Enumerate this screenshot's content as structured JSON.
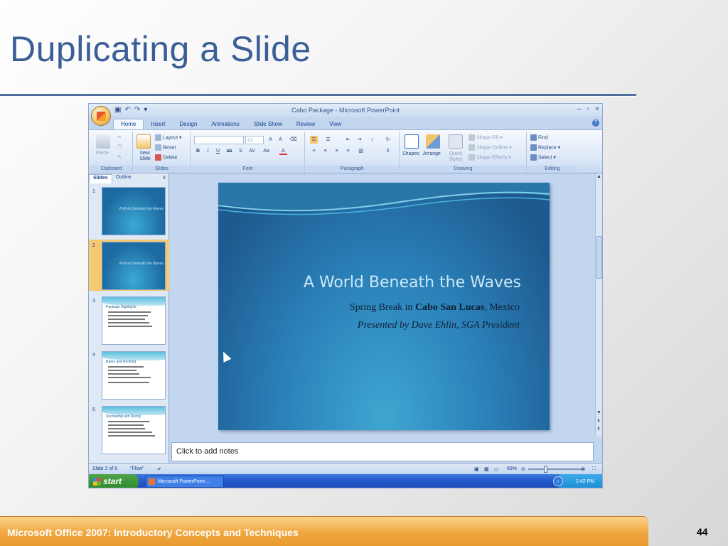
{
  "page": {
    "title": "Duplicating a Slide",
    "footer": "Microsoft Office 2007: Introductory Concepts and Techniques",
    "page_number": "44"
  },
  "window": {
    "title": "Cabo Package - Microsoft PowerPoint",
    "controls": [
      "–",
      "▫",
      "×"
    ]
  },
  "ribbon": {
    "tabs": [
      "Home",
      "Insert",
      "Design",
      "Animations",
      "Slide Show",
      "Review",
      "View"
    ],
    "active_tab": "Home",
    "groups": {
      "clipboard": {
        "label": "Clipboard",
        "paste": "Paste"
      },
      "slides": {
        "label": "Slides",
        "new_slide": "New Slide",
        "layout": "Layout",
        "reset": "Reset",
        "delete": "Delete"
      },
      "font": {
        "label": "Font",
        "size": "21"
      },
      "paragraph": {
        "label": "Paragraph"
      },
      "drawing": {
        "label": "Drawing",
        "shapes": "Shapes",
        "arrange": "Arrange",
        "quick_styles": "Quick Styles",
        "shape_fill": "Shape Fill",
        "shape_outline": "Shape Outline",
        "shape_effects": "Shape Effects"
      },
      "editing": {
        "label": "Editing",
        "find": "Find",
        "replace": "Replace",
        "select": "Select"
      }
    }
  },
  "panel": {
    "tabs": [
      "Slides",
      "Outline"
    ],
    "thumbnails": [
      {
        "num": "1",
        "title": "A World Beneath the Waves",
        "style": "blue"
      },
      {
        "num": "2",
        "title": "A World Beneath the Waves",
        "style": "blue",
        "selected": true
      },
      {
        "num": "3",
        "title": "Package Highlights",
        "style": "white"
      },
      {
        "num": "4",
        "title": "Rates and Booking",
        "style": "white"
      },
      {
        "num": "5",
        "title": "Snorkeling and Diving",
        "style": "white"
      }
    ]
  },
  "slide": {
    "title": "A World Beneath the Waves",
    "sub1_pre": "Spring Break in ",
    "sub1_bold": "Cabo San Lucas",
    "sub1_post": ", Mexico",
    "sub2": "Presented by Dave Ehlin, SGA President"
  },
  "notes": {
    "placeholder": "Click to add notes"
  },
  "status": {
    "slide_info": "Slide 2 of 5",
    "theme": "\"Flow\"",
    "zoom": "69%"
  },
  "taskbar": {
    "start": "start",
    "item": "Microsoft PowerPoint ...",
    "clock": "2:42 PM"
  }
}
